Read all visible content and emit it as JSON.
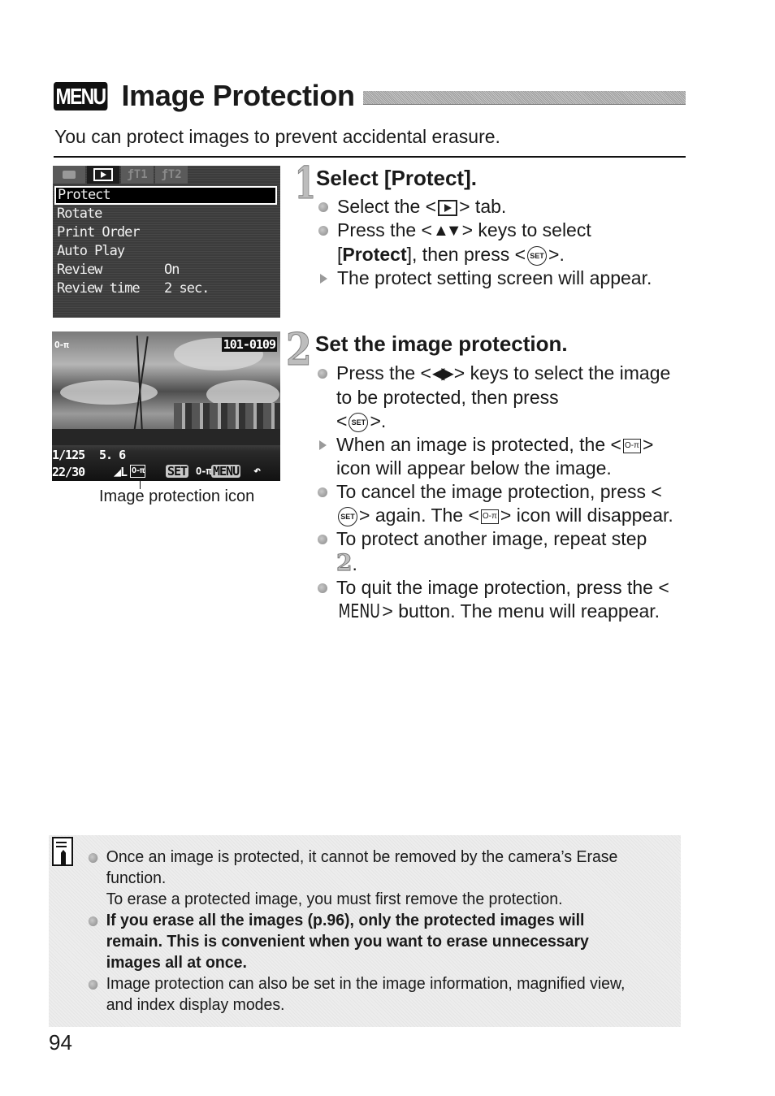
{
  "header": {
    "badge": "MENU",
    "title": "Image Protection",
    "intro": "You can protect images to prevent accidental erasure."
  },
  "menu_screen": {
    "tabs": [
      {
        "icon": "camera-icon",
        "label": ""
      },
      {
        "icon": "playback-icon",
        "label": ""
      },
      {
        "icon": "setup1-icon",
        "label": "ƒT1"
      },
      {
        "icon": "setup2-icon",
        "label": "ƒT2"
      }
    ],
    "active_tab": 1,
    "items": [
      {
        "label": "Protect",
        "value": "",
        "selected": true
      },
      {
        "label": "Rotate",
        "value": ""
      },
      {
        "label": "Print Order",
        "value": ""
      },
      {
        "label": "Auto Play",
        "value": ""
      },
      {
        "label": "Review",
        "value": "On"
      },
      {
        "label": "Review time",
        "value": "2 sec."
      }
    ]
  },
  "playback_screen": {
    "key_icon": "O‑π",
    "file_number": "101-0109",
    "shutter": "1/125",
    "aperture": "5. 6",
    "count": "22/30",
    "quality": "◢L",
    "protect_icon": "O‑π",
    "set_label": "SET",
    "key_between": "O‑π",
    "menu_label": "MENU",
    "return_icon": "↶",
    "caption": "Image protection icon"
  },
  "step1": {
    "number": "1",
    "title": "Select [Protect].",
    "lines": {
      "a_pre": "Select the <",
      "a_post": "> tab.",
      "b_pre": "Press the <",
      "b_arrows": "▲▼",
      "b_mid": "> keys to select",
      "b_line2_bold": "Protect",
      "b_line2_pre": "[",
      "b_line2_post": "], then press <",
      "b_end": ">.",
      "c": "The protect setting screen will appear."
    }
  },
  "step2": {
    "number": "2",
    "title": "Set the image protection.",
    "lines": {
      "a_pre": "Press the <",
      "a_arrows": "◀▶",
      "a_post": "> keys to select the image to be protected, then press",
      "a_end_pre": "<",
      "a_end_post": ">.",
      "b_pre": "When an image is protected, the <",
      "b_post": "> icon will appear below the image.",
      "c_pre": "To cancel the image protection, press <",
      "c_mid": "> again. The <",
      "c_post": "> icon will disappear.",
      "d_pre": "To protect another image, repeat step",
      "d_step": "2",
      "d_post": ".",
      "e_pre": "To quit the image protection, press the <",
      "e_menu": "MENU",
      "e_post": "> button. The menu will reappear."
    }
  },
  "symbols": {
    "set": "SET",
    "key": "O‑π"
  },
  "note": {
    "items": [
      {
        "text": "Once an image is protected, it cannot be removed by the camera’s Erase function.",
        "text2": "To erase a protected image, you must first remove the protection.",
        "bold": false
      },
      {
        "text": "If you erase all the images (p.96), only the protected images will remain. This is convenient when you want to erase unnecessary images all at once.",
        "bold": true
      },
      {
        "text": "Image protection can also be set in the image information, magnified view, and index display modes.",
        "bold": false
      }
    ]
  },
  "page_number": "94"
}
